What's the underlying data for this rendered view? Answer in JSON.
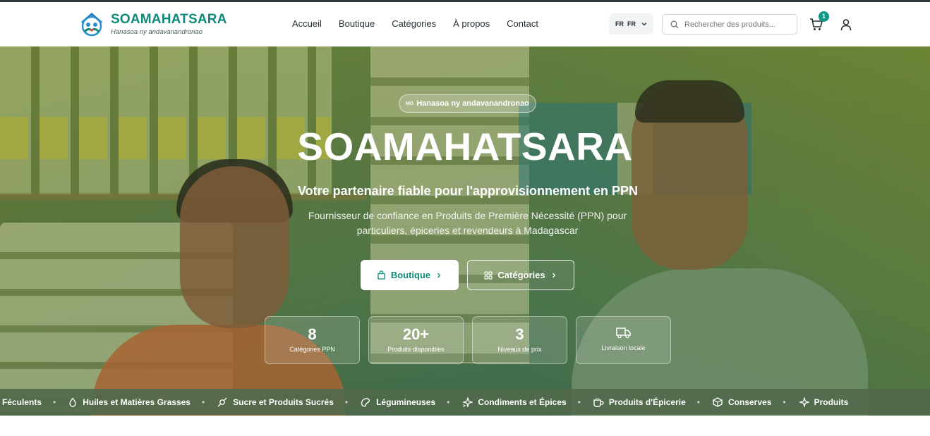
{
  "brand": {
    "name": "SOAMAHATSARA",
    "tagline": "Hanasoa ny andavanandronao",
    "color": "#0f8a7a"
  },
  "nav": [
    "Accueil",
    "Boutique",
    "Catégories",
    "À propos",
    "Contact"
  ],
  "lang": {
    "flag": "FR",
    "code": "FR"
  },
  "search": {
    "placeholder": "Rechercher des produits..."
  },
  "cart": {
    "count": "1"
  },
  "hero": {
    "badge_prefix": "MG",
    "badge": "Hanasoa ny andavanandronao",
    "title": "SOAMAHATSARA",
    "subtitle": "Votre partenaire fiable pour l'approvisionnement en PPN",
    "description": "Fournisseur de confiance en Produits de Première Nécessité (PPN) pour particuliers, épiceries et revendeurs à Madagascar",
    "btn_shop": "Boutique",
    "btn_categories": "Catégories"
  },
  "stats": [
    {
      "value": "8",
      "label": "Catégories PPN"
    },
    {
      "value": "20+",
      "label": "Produits disponibles"
    },
    {
      "value": "3",
      "label": "Niveaux de prix"
    },
    {
      "value": "",
      "label": "Livraison locale"
    }
  ],
  "ticker": [
    "Féculents",
    "Huiles et Matières Grasses",
    "Sucre et Produits Sucrés",
    "Légumineuses",
    "Condiments et Épices",
    "Produits d'Épicerie",
    "Conserves",
    "Produits"
  ],
  "colors": {
    "accent": "#0f8a7a",
    "badge": "#0f9a88",
    "ticker_bg": "#50694b"
  }
}
